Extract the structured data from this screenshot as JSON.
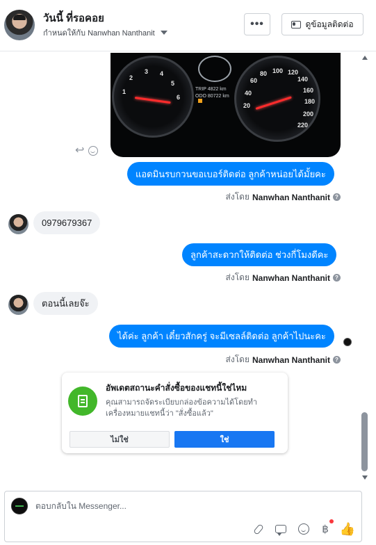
{
  "header": {
    "name": "วันนี้ ที่รอคอย",
    "assigned_label": "กำหนดให้กับ Nanwhan Nanthanit",
    "more_label": "•••",
    "contact_button": "ดูข้อมูลติดต่อ",
    "icons": [
      "more-dots-icon",
      "contact-card-icon",
      "chevron-down-icon"
    ]
  },
  "dashboard_image": {
    "left_gauge_numbers": [
      "2",
      "3",
      "4",
      "5",
      "6",
      "1"
    ],
    "right_gauge_numbers": [
      "80",
      "100",
      "120",
      "140",
      "60",
      "160",
      "40",
      "180",
      "20",
      "200",
      "220"
    ],
    "trip_label": "TRIP",
    "trip_value": "4822 km",
    "odo_label": "ODO",
    "odo_value": "80722 km"
  },
  "messages": [
    {
      "dir": "out",
      "text": "แอดมินรบกวนขอเบอร์ติดต่อ ลูกค้าหน่อยได้มั้ยคะ"
    },
    {
      "dir": "in",
      "text": "0979679367"
    },
    {
      "dir": "out",
      "text": "ลูกค้าสะดวกให้ติดต่อ ช่วงกี่โมงดีคะ"
    },
    {
      "dir": "in",
      "text": "ตอนนี้เลยจ๊ะ"
    },
    {
      "dir": "out",
      "text": "ได้ค่ะ ลูกค้า เดี๋ยวสักครู่ จะมีเซลล์ติดต่อ ลูกค้าไปนะคะ"
    }
  ],
  "sent_by": {
    "prefix": "ส่งโดย",
    "name": "Nanwhan Nanthanit",
    "info": "?"
  },
  "card": {
    "title": "อัพเดตสถานะคำสั่งซื้อของแชทนี้ใช่ไหม",
    "description": "คุณสามารถจัดระเบียบกล่องข้อความได้โดยทำเครื่องหมายแชทนี้ว่า \"สั่งซื้อแล้ว\"",
    "no_label": "ไม่ใช่",
    "yes_label": "ใช่"
  },
  "composer": {
    "placeholder": "ตอบกลับใน Messenger...",
    "baht_symbol": "฿",
    "like_symbol": "👍"
  },
  "colors": {
    "accent": "#0084ff",
    "card_icon": "#42b72a",
    "yes_button": "#1877f2"
  }
}
